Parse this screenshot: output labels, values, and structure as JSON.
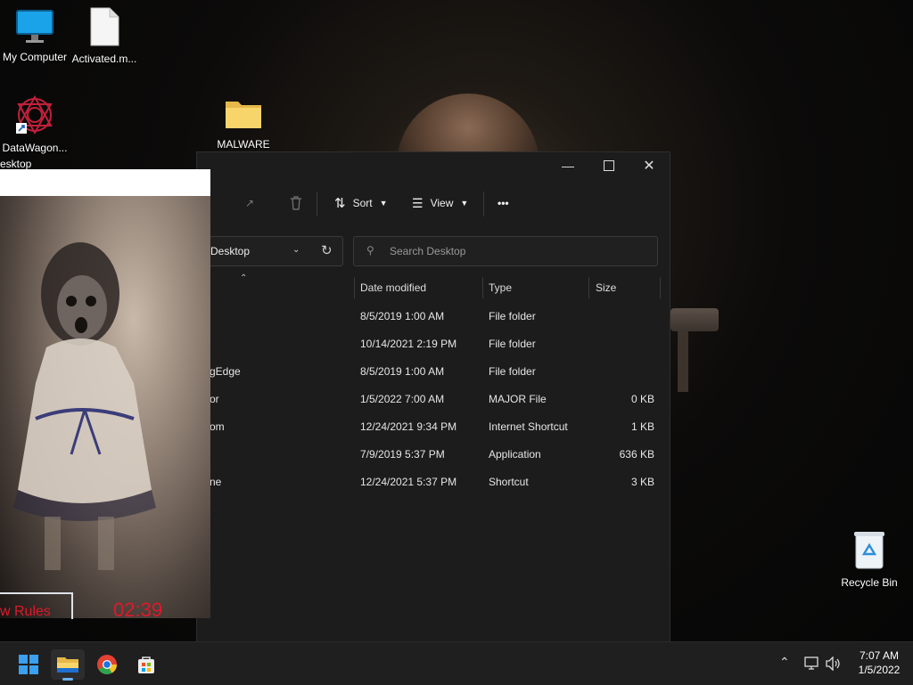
{
  "desktop": {
    "icons": [
      {
        "label": "My Computer",
        "icon": "monitor-icon"
      },
      {
        "label": "Activated.m...",
        "icon": "file-icon"
      },
      {
        "label": "DataWagon...",
        "icon": "datawagon-icon"
      },
      {
        "label": "MALWARE",
        "icon": "folder-icon"
      },
      {
        "label": "Recycle Bin",
        "icon": "recycle-bin-icon"
      }
    ],
    "partial_title": "esktop"
  },
  "explorer": {
    "toolbar": {
      "sort": "Sort",
      "view": "View",
      "more": "•••"
    },
    "address": "Desktop",
    "search_placeholder": "Search Desktop",
    "columns": {
      "date": "Date modified",
      "type": "Type",
      "size": "Size"
    },
    "rows": [
      {
        "name": "",
        "date": "8/5/2019 1:00 AM",
        "type": "File folder",
        "size": ""
      },
      {
        "name": "",
        "date": "10/14/2021 2:19 PM",
        "type": "File folder",
        "size": ""
      },
      {
        "name": "gEdge",
        "date": "8/5/2019 1:00 AM",
        "type": "File folder",
        "size": ""
      },
      {
        "name": "or",
        "date": "1/5/2022 7:00 AM",
        "type": "MAJOR File",
        "size": "0 KB"
      },
      {
        "name": "om",
        "date": "12/24/2021 9:34 PM",
        "type": "Internet Shortcut",
        "size": "1 KB"
      },
      {
        "name": "",
        "date": "7/9/2019 5:37 PM",
        "type": "Application",
        "size": "636 KB"
      },
      {
        "name": "ne",
        "date": "12/24/2021 5:37 PM",
        "type": "Shortcut",
        "size": "3 KB"
      }
    ]
  },
  "ransom": {
    "rules_button": "w Rules",
    "timer": "02:39",
    "timer_color": "#e0182a"
  },
  "taskbar": {
    "time": "7:07 AM",
    "date": "1/5/2022"
  }
}
